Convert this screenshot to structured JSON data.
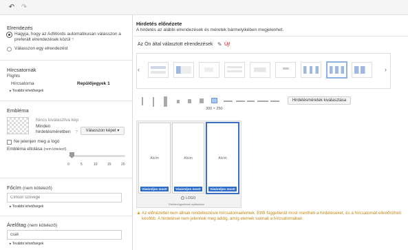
{
  "toolbar": {
    "undo_icon": "undo-icon",
    "redo_icon": "redo-icon"
  },
  "left": {
    "layouts": {
      "title": "Elrendezés",
      "option_auto": "Hagyja, hogy az AdWords automatikusan válasszon a preferált elrendezések közül",
      "option_auto_help": "?",
      "option_single": "Válasszon egy elrendezést"
    },
    "channels": {
      "title": "Hírcsatornák",
      "subtitle": "Flights",
      "row_label": "Hírcsatorna",
      "row_value": "Repülőjegyek 1",
      "more_link": "▸ További lehetőségek"
    },
    "logo": {
      "title": "Embléma",
      "no_image": "Nincs kiválasztva kép",
      "all_sizes_1": "Minden",
      "all_sizes_2": "hirdetésméretben",
      "help": "?",
      "choose_image": "Válasszon képet ▾",
      "hide_logo": "Ne jelenjen meg a logó",
      "offset_label": "Embléma eltolása",
      "offset_optional": "(nem kötelező)",
      "slider_value": 0,
      "slider_ticks": [
        "0",
        "5",
        "10",
        "15",
        "20"
      ]
    },
    "heading": {
      "title": "Főcím",
      "optional": "(nem kötelező)",
      "placeholder": "Címsor szövege",
      "more_link": "▸ További lehetőségek"
    },
    "price": {
      "title": "Árelőtag",
      "optional": "(nem kötelező)",
      "value": "csak",
      "more_link": "▸ További lehetőségek"
    }
  },
  "right": {
    "preview_title": "Hirdetés előnézete",
    "preview_subtitle": "A hirdetés az alábbi elrendezések és méretek bármelyikében megjelenhet.",
    "selected_layouts": "Az Ön által választott elrendezések",
    "new_link": "Új!",
    "size_label": "300 × 250",
    "choose_sizes_button": "Hirdetésméretek kiválasztása",
    "ad_title": "Alcím",
    "ad_cta": "Vásároljon most!",
    "logo_text": "LOGO",
    "logo_caption": "Reklámügyeltetek nyitásához",
    "warning_text": "Az előnézettel nem állnak rendelkezésre hírcsatornaelemek. Ettől függetlenül most mentheti a hirdetéseket, és a hírcsatornát ellenőrizheti később. A hirdetései nem jelennek meg addig, amíg elemek vannak a hírcsatornában."
  },
  "colors": {
    "accent_blue": "#2a6ac7",
    "warning": "#e8a020",
    "new_red": "#cc0000"
  }
}
